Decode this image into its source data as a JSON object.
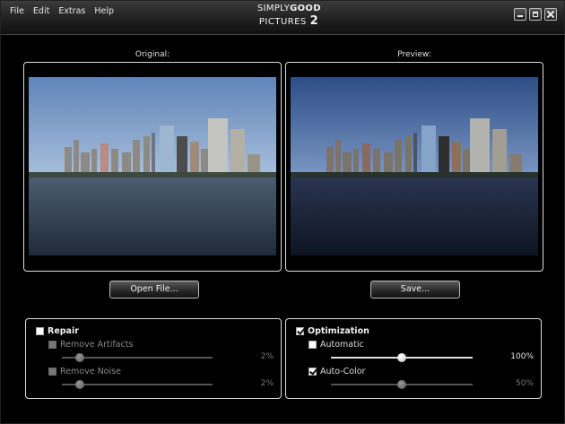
{
  "app": {
    "logo_line1_a": "SIMPLY",
    "logo_line1_b": "GOOD",
    "logo_line2_a": "PICTURES",
    "logo_line2_b": "2"
  },
  "menu": [
    "File",
    "Edit",
    "Extras",
    "Help"
  ],
  "original": {
    "label": "Original:",
    "button": "Open File..."
  },
  "preview": {
    "label": "Preview:",
    "button": "Save..."
  },
  "repair": {
    "title": "Repair",
    "checked": false,
    "remove_artifacts": {
      "label": "Remove Artifacts",
      "checked": false,
      "value_text": "2%",
      "level": 0.02
    },
    "remove_noise": {
      "label": "Remove Noise",
      "checked": false,
      "value_text": "2%",
      "level": 0.02
    }
  },
  "optimization": {
    "title": "Optimization",
    "checked": true,
    "automatic": {
      "label": "Automatic",
      "checked": false,
      "value_text": "100%",
      "level": 0.5
    },
    "auto_color": {
      "label": "Auto-Color",
      "checked": true,
      "value_text": "50%",
      "level": 0.5
    }
  },
  "colors": {
    "background": "#000000",
    "border": "#dddddd",
    "sky": "#7f9fc9",
    "water": "#2c3a4c"
  }
}
